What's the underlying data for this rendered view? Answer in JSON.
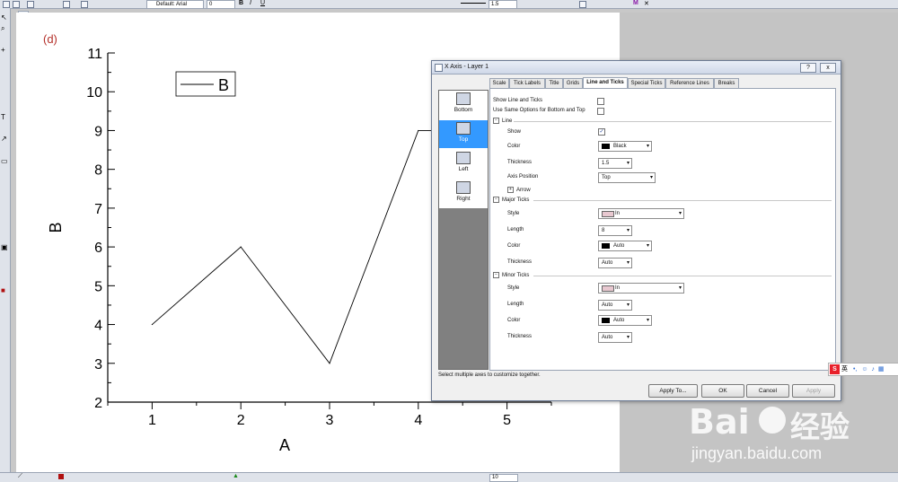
{
  "toolbar": {
    "font_name": "Default: Arial",
    "font_size": "0",
    "line_width": "1.5",
    "bottom_size": "10",
    "window_tab": "1"
  },
  "graph": {
    "panel_label": "(d)",
    "legend_label": "B",
    "chart_data": {
      "type": "line",
      "x": [
        1,
        2,
        3,
        4,
        5
      ],
      "series": [
        {
          "name": "B",
          "values": [
            4,
            6,
            3,
            9,
            9
          ]
        }
      ],
      "xlabel": "A",
      "ylabel": "B",
      "xlim": [
        0.5,
        5.5
      ],
      "ylim": [
        2,
        11
      ],
      "x_ticks": [
        "1",
        "2",
        "3",
        "4",
        "5"
      ],
      "y_ticks": [
        "2",
        "3",
        "4",
        "5",
        "6",
        "7",
        "8",
        "9",
        "10",
        "11"
      ],
      "grid": false,
      "legend_position": "top-left",
      "line_color": "#000000"
    }
  },
  "dialog": {
    "title": "X Axis - Layer 1",
    "help_icon": "?",
    "close_icon": "x",
    "tabs": [
      {
        "label": "Scale"
      },
      {
        "label": "Tick Labels"
      },
      {
        "label": "Title"
      },
      {
        "label": "Grids"
      },
      {
        "label": "Line and Ticks"
      },
      {
        "label": "Special Ticks"
      },
      {
        "label": "Reference Lines"
      },
      {
        "label": "Breaks"
      }
    ],
    "active_tab": "Line and Ticks",
    "axes": [
      {
        "label": "Bottom"
      },
      {
        "label": "Top"
      },
      {
        "label": "Left"
      },
      {
        "label": "Right"
      }
    ],
    "selected_axis": "Top",
    "show_line_and_ticks_label": "Show Line and Ticks",
    "use_same_options_label": "Use Same Options for Bottom and Top",
    "line_section": {
      "title": "Line",
      "show_label": "Show",
      "show_checked": true,
      "color_label": "Color",
      "color_value": "Black",
      "thickness_label": "Thickness",
      "thickness_value": "1.5",
      "axis_position_label": "Axis Position",
      "axis_position_value": "Top",
      "arrow_label": "Arrow"
    },
    "major_ticks": {
      "title": "Major Ticks",
      "style_label": "Style",
      "style_value": "In",
      "length_label": "Length",
      "length_value": "8",
      "color_label": "Color",
      "color_value": "Auto",
      "thickness_label": "Thickness",
      "thickness_value": "Auto"
    },
    "minor_ticks": {
      "title": "Minor Ticks",
      "style_label": "Style",
      "style_value": "In",
      "length_label": "Length",
      "length_value": "Auto",
      "color_label": "Color",
      "color_value": "Auto",
      "thickness_label": "Thickness",
      "thickness_value": "Auto"
    },
    "status_text": "Select multiple axes to customize together.",
    "buttons": {
      "apply_to": "Apply To...",
      "ok": "OK",
      "cancel": "Cancel",
      "apply": "Apply"
    }
  },
  "annotations": {
    "highlight_color": "#e8202a"
  },
  "ime_bar": {
    "text": "英"
  },
  "watermark": {
    "brand": "Bai",
    "brand_cn": "经验",
    "url": "jingyan.baidu.com"
  }
}
